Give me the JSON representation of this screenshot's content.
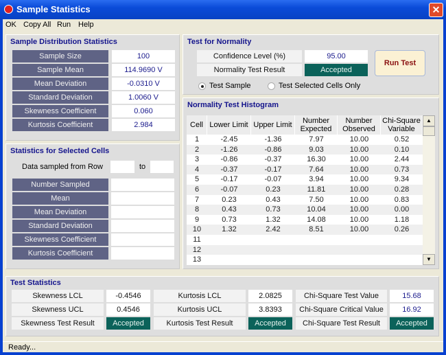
{
  "window": {
    "title": "Sample Statistics",
    "close": "✕"
  },
  "menu": [
    "OK",
    "Copy All",
    "Run",
    "Help"
  ],
  "sample": {
    "title": "Sample Distribution Statistics",
    "rows": [
      {
        "label": "Sample Size",
        "value": "100"
      },
      {
        "label": "Sample Mean",
        "value": "114.9690 V"
      },
      {
        "label": "Mean Deviation",
        "value": "-0.0310 V"
      },
      {
        "label": "Standard Deviation",
        "value": "1.0060 V"
      },
      {
        "label": "Skewness Coefficient",
        "value": "0.060"
      },
      {
        "label": "Kurtosis Coefficient",
        "value": "2.984"
      }
    ]
  },
  "selected": {
    "title": "Statistics for Selected Cells",
    "row_label": "Data sampled from Row",
    "to": "to",
    "from_value": "",
    "to_value": "",
    "rows": [
      {
        "label": "Number Sampled",
        "value": ""
      },
      {
        "label": "Mean",
        "value": ""
      },
      {
        "label": "Mean Deviation",
        "value": ""
      },
      {
        "label": "Standard Deviation",
        "value": ""
      },
      {
        "label": "Skewness Coefficient",
        "value": ""
      },
      {
        "label": "Kurtosis Coefficient",
        "value": ""
      }
    ]
  },
  "normality": {
    "title": "Test for Normality",
    "confidence_label": "Confidence Level (%)",
    "confidence_value": "95.00",
    "result_label": "Normality Test Result",
    "result_value": "Accepted",
    "run_button": "Run Test",
    "radio_sample": "Test Sample",
    "radio_selected": "Test Selected Cells Only",
    "selected_radio": "Test Sample"
  },
  "histogram": {
    "title": "Normality Test Histogram",
    "columns": [
      "Cell",
      "Lower Limit",
      "Upper Limit",
      "Number Expected",
      "Number Observed",
      "Chi-Square Variable"
    ],
    "rows": [
      [
        "1",
        "-2.45",
        "-1.36",
        "7.97",
        "10.00",
        "0.52"
      ],
      [
        "2",
        "-1.26",
        "-0.86",
        "9.03",
        "10.00",
        "0.10"
      ],
      [
        "3",
        "-0.86",
        "-0.37",
        "16.30",
        "10.00",
        "2.44"
      ],
      [
        "4",
        "-0.37",
        "-0.17",
        "7.64",
        "10.00",
        "0.73"
      ],
      [
        "5",
        "-0.17",
        "-0.07",
        "3.94",
        "10.00",
        "9.34"
      ],
      [
        "6",
        "-0.07",
        "0.23",
        "11.81",
        "10.00",
        "0.28"
      ],
      [
        "7",
        "0.23",
        "0.43",
        "7.50",
        "10.00",
        "0.83"
      ],
      [
        "8",
        "0.43",
        "0.73",
        "10.04",
        "10.00",
        "0.00"
      ],
      [
        "9",
        "0.73",
        "1.32",
        "14.08",
        "10.00",
        "1.18"
      ],
      [
        "10",
        "1.32",
        "2.42",
        "8.51",
        "10.00",
        "0.26"
      ],
      [
        "11",
        "",
        "",
        "",
        "",
        ""
      ],
      [
        "12",
        "",
        "",
        "",
        "",
        ""
      ],
      [
        "13",
        "",
        "",
        "",
        "",
        ""
      ]
    ]
  },
  "test_stats": {
    "title": "Test Statistics",
    "skew_lcl_label": "Skewness LCL",
    "skew_lcl": "-0.4546",
    "skew_ucl_label": "Skewness UCL",
    "skew_ucl": "0.4546",
    "skew_result_label": "Skewness Test Result",
    "skew_result": "Accepted",
    "kurt_lcl_label": "Kurtosis LCL",
    "kurt_lcl": "2.0825",
    "kurt_ucl_label": "Kurtosis UCL",
    "kurt_ucl": "3.8393",
    "kurt_result_label": "Kurtosis Test Result",
    "kurt_result": "Accepted",
    "chi_value_label": "Chi-Square Test Value",
    "chi_value": "15.68",
    "chi_crit_label": "Chi-Square Critical Value",
    "chi_crit": "16.92",
    "chi_result_label": "Chi-Square Test Result",
    "chi_result": "Accepted"
  },
  "status": "Ready...",
  "colors": {
    "accepted": "#0b625a",
    "label_bg": "#5f6385",
    "value_text": "#1a1a8c",
    "run_text": "#8a1010"
  }
}
